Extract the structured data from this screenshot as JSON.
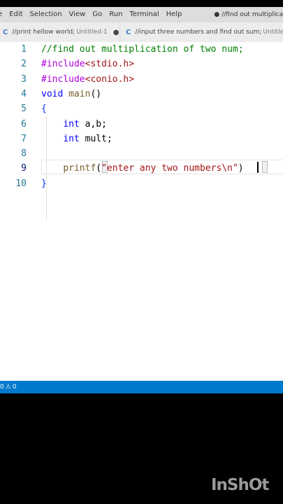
{
  "menubar": {
    "items": [
      "e",
      "Edit",
      "Selection",
      "View",
      "Go",
      "Run",
      "Terminal",
      "Help"
    ],
    "window_title": "//find out multiplica"
  },
  "tabs": [
    {
      "icon": "C",
      "label": "//print hellow world;",
      "desc": "Untitled-1",
      "modified_dot": "●"
    },
    {
      "icon": "C",
      "label": "//input three numbers and find out sum;",
      "desc": "Untitled-"
    }
  ],
  "editor": {
    "line_numbers": [
      "1",
      "2",
      "3",
      "4",
      "5",
      "6",
      "7",
      "8",
      "9",
      "10"
    ],
    "lines": [
      [
        {
          "t": "comment",
          "v": "//find out multiplication of two num;"
        }
      ],
      [
        {
          "t": "pre",
          "v": "#include"
        },
        {
          "t": "str",
          "v": "<stdio.h>"
        }
      ],
      [
        {
          "t": "pre",
          "v": "#include"
        },
        {
          "t": "str",
          "v": "<conio.h>"
        }
      ],
      [
        {
          "t": "key",
          "v": "void"
        },
        {
          "t": "plain",
          "v": " "
        },
        {
          "t": "fn",
          "v": "main"
        },
        {
          "t": "plain",
          "v": "()"
        }
      ],
      [
        {
          "t": "brace",
          "v": "{"
        }
      ],
      [
        {
          "t": "plain",
          "v": "    "
        },
        {
          "t": "key",
          "v": "int"
        },
        {
          "t": "plain",
          "v": " a,b;"
        }
      ],
      [
        {
          "t": "plain",
          "v": "    "
        },
        {
          "t": "key",
          "v": "int"
        },
        {
          "t": "plain",
          "v": " mult;"
        }
      ],
      [
        {
          "t": "plain",
          "v": ""
        }
      ],
      [
        {
          "t": "plain",
          "v": "    "
        },
        {
          "t": "fn",
          "v": "printf"
        },
        {
          "t": "plain",
          "v": "("
        },
        {
          "t": "str",
          "v": "\"enter any two numbers\\n\""
        },
        {
          "t": "plain",
          "v": ")"
        }
      ],
      [
        {
          "t": "brace",
          "v": "}"
        }
      ]
    ],
    "current_line": 9
  },
  "status": {
    "problems": "0",
    "warnings": "0"
  },
  "watermark": "InShOt",
  "colors": {
    "statusbar": "#007acc",
    "menubar": "#dddddd",
    "tabbar": "#ececec"
  }
}
